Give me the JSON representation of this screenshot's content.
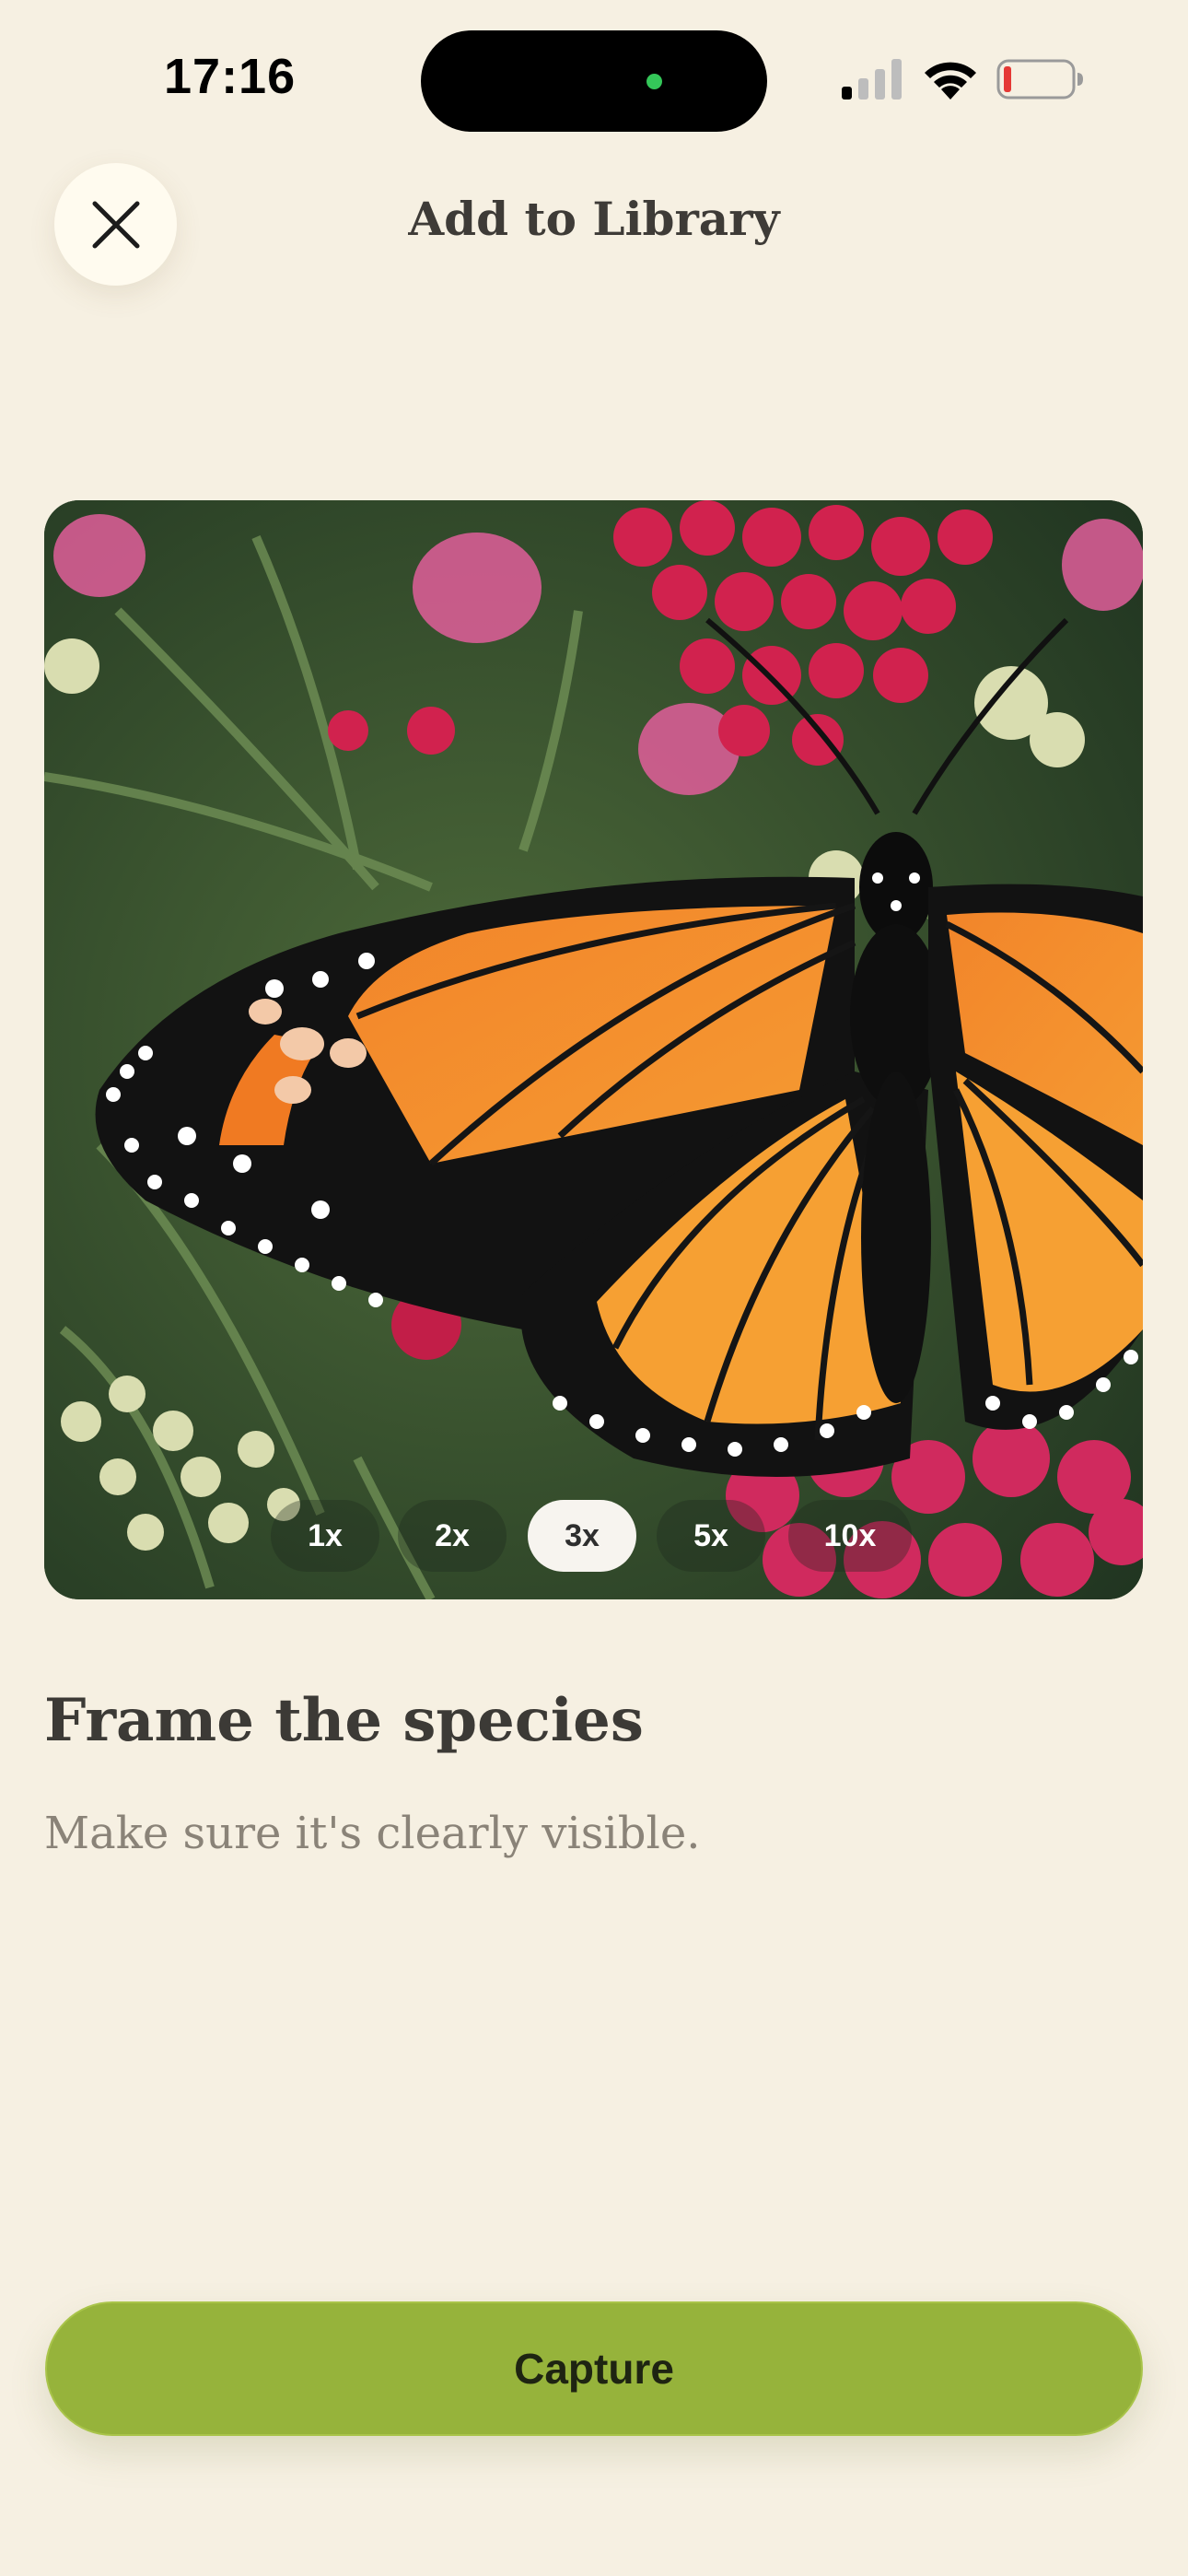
{
  "status_bar": {
    "time": "17:16"
  },
  "header": {
    "title": "Add to Library",
    "close_icon": "close-icon"
  },
  "camera": {
    "zoom_levels": [
      "1x",
      "2x",
      "3x",
      "5x",
      "10x"
    ],
    "selected_zoom": "3x"
  },
  "instructions": {
    "title": "Frame the species",
    "subtitle": "Make sure it's clearly visible."
  },
  "actions": {
    "capture_label": "Capture"
  },
  "colors": {
    "background": "#F6F0E2",
    "accent": "#96B33B"
  }
}
